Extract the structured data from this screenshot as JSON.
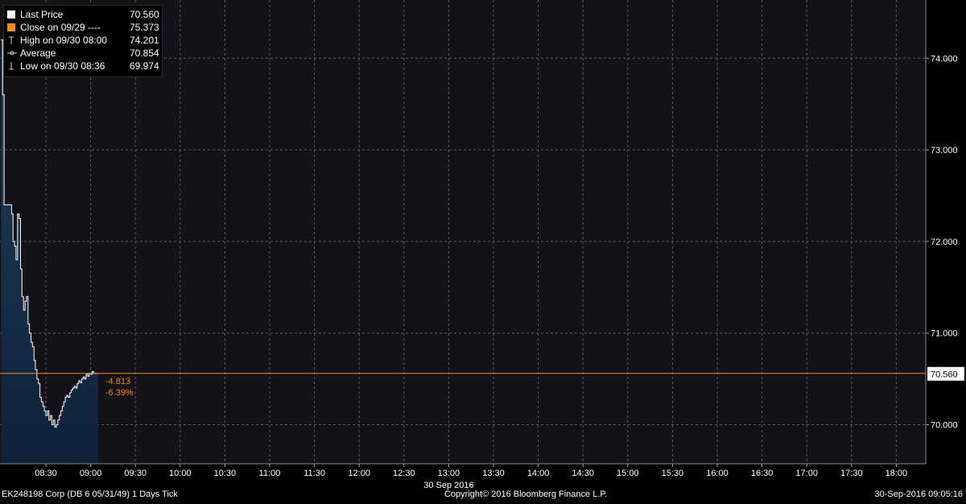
{
  "chart_data": {
    "type": "line",
    "title": "",
    "xlabel": "30 Sep 2016",
    "ylabel": "",
    "ylim": [
      69.6,
      74.55
    ],
    "x_ticks": [
      "08:30",
      "09:00",
      "09:30",
      "10:00",
      "10:30",
      "11:00",
      "11:30",
      "12:00",
      "12:30",
      "13:00",
      "13:30",
      "14:00",
      "14:30",
      "15:00",
      "15:30",
      "16:00",
      "16:30",
      "17:00",
      "17:30",
      "18:00"
    ],
    "y_ticks": [
      "70.000",
      "71.000",
      "72.000",
      "73.000",
      "74.000"
    ],
    "y_tick_values": [
      70,
      71,
      72,
      73,
      74
    ],
    "grid": true,
    "legend_position": "top-left",
    "series": [
      {
        "name": "Last Price",
        "x": [
          "08:00",
          "08:01",
          "08:02",
          "08:03",
          "08:04",
          "08:05",
          "08:06",
          "08:07",
          "08:08",
          "08:09",
          "08:10",
          "08:11",
          "08:12",
          "08:13",
          "08:14",
          "08:15",
          "08:16",
          "08:17",
          "08:18",
          "08:19",
          "08:20",
          "08:21",
          "08:22",
          "08:23",
          "08:24",
          "08:25",
          "08:26",
          "08:27",
          "08:28",
          "08:29",
          "08:30",
          "08:31",
          "08:32",
          "08:33",
          "08:34",
          "08:35",
          "08:36",
          "08:37",
          "08:38",
          "08:39",
          "08:40",
          "08:41",
          "08:42",
          "08:43",
          "08:44",
          "08:45",
          "08:46",
          "08:47",
          "08:48",
          "08:49",
          "08:50",
          "08:51",
          "08:52",
          "08:53",
          "08:54",
          "08:55",
          "08:56",
          "08:57",
          "08:58",
          "08:59",
          "09:00",
          "09:01",
          "09:02",
          "09:03",
          "09:04",
          "09:05"
        ],
        "values": [
          74.201,
          73.6,
          72.4,
          72.4,
          72.4,
          72.4,
          72.4,
          72.3,
          72.0,
          71.95,
          71.8,
          72.3,
          72.25,
          71.7,
          71.4,
          71.25,
          71.35,
          71.4,
          71.1,
          71.0,
          70.9,
          70.85,
          70.7,
          70.6,
          70.5,
          70.45,
          70.3,
          70.25,
          70.2,
          70.15,
          70.1,
          70.15,
          70.05,
          70.1,
          70.0,
          70.05,
          69.974,
          70.0,
          70.05,
          70.1,
          70.15,
          70.2,
          70.25,
          70.3,
          70.32,
          70.3,
          70.35,
          70.38,
          70.4,
          70.42,
          70.4,
          70.45,
          70.48,
          70.46,
          70.5,
          70.52,
          70.5,
          70.55,
          70.53,
          70.56,
          70.55,
          70.58,
          70.56,
          70.56,
          70.56,
          70.56
        ]
      }
    ],
    "last_price": 70.56,
    "close_prior": 75.373,
    "change": "-4.813",
    "change_pct": "-6.39%",
    "last_price_label": "70.560"
  },
  "legend": [
    {
      "label": "Last Price",
      "value": "70.560",
      "icon": "white-square"
    },
    {
      "label": "Close on 09/29 ----",
      "value": "75.373",
      "icon": "orange-square"
    },
    {
      "label": "High on 09/30 08:00",
      "value": "74.201",
      "icon": "high-marker-icon"
    },
    {
      "label": "Average",
      "value": "70.854",
      "icon": "average-marker-icon"
    },
    {
      "label": "Low on 09/30 08:36",
      "value": "69.974",
      "icon": "low-marker-icon"
    }
  ],
  "footer": {
    "security": "EK248198 Corp (DB 6 05/31/49) 1 Days  Tick",
    "copyright": "Copyright© 2016 Bloomberg Finance L.P.",
    "timestamp": "30-Sep-2016 09:05:16"
  },
  "colors": {
    "orange": "#f08c1e",
    "white": "#ffffff",
    "grid": "#6a6a6a",
    "fill_top": "#1f3f5e",
    "fill_bottom": "#0f2238",
    "axis_bg": "#0f0f0f"
  }
}
